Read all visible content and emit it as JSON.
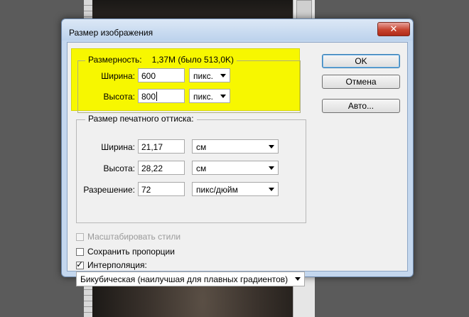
{
  "dialog": {
    "title": "Размер изображения",
    "close_label": "✕"
  },
  "pixel_dimensions": {
    "legend": "Размерность:",
    "size_info": "1,37M (было 513,0K)",
    "width_label": "Ширина:",
    "width_value": "600",
    "width_unit": "пикс.",
    "height_label": "Высота:",
    "height_value": "800",
    "height_unit": "пикс.",
    "highlight_color": "#f7f700"
  },
  "document_size": {
    "legend": "Размер печатного оттиска:",
    "width_label": "Ширина:",
    "width_value": "21,17",
    "width_unit": "см",
    "height_label": "Высота:",
    "height_value": "28,22",
    "height_unit": "см",
    "resolution_label": "Разрешение:",
    "resolution_value": "72",
    "resolution_unit": "пикс/дюйм"
  },
  "options": {
    "scale_styles_label": "Масштабировать стили",
    "scale_styles_checked": false,
    "scale_styles_enabled": false,
    "constrain_label": "Сохранить пропорции",
    "constrain_checked": false,
    "resample_label": "Интерполяция:",
    "resample_checked": true,
    "resample_method": "Бикубическая (наилучшая для плавных градиентов)"
  },
  "buttons": {
    "ok_label": "OK",
    "cancel_label": "Отмена",
    "auto_label": "Авто..."
  }
}
